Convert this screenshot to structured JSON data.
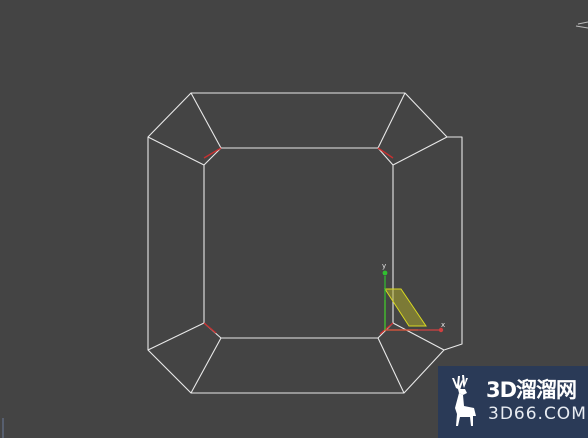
{
  "viewport": {
    "background": "#444444",
    "wire_color": "#e8e8e8",
    "seam_color": "#c83030"
  },
  "gizmo": {
    "x_label": "x",
    "y_label": "y",
    "x_color": "#d04040",
    "y_color": "#30c030",
    "plane_color": "#d8d820"
  },
  "watermark": {
    "title": "3D溜溜网",
    "url": "3D66.COM",
    "background": "#2a3a57"
  }
}
